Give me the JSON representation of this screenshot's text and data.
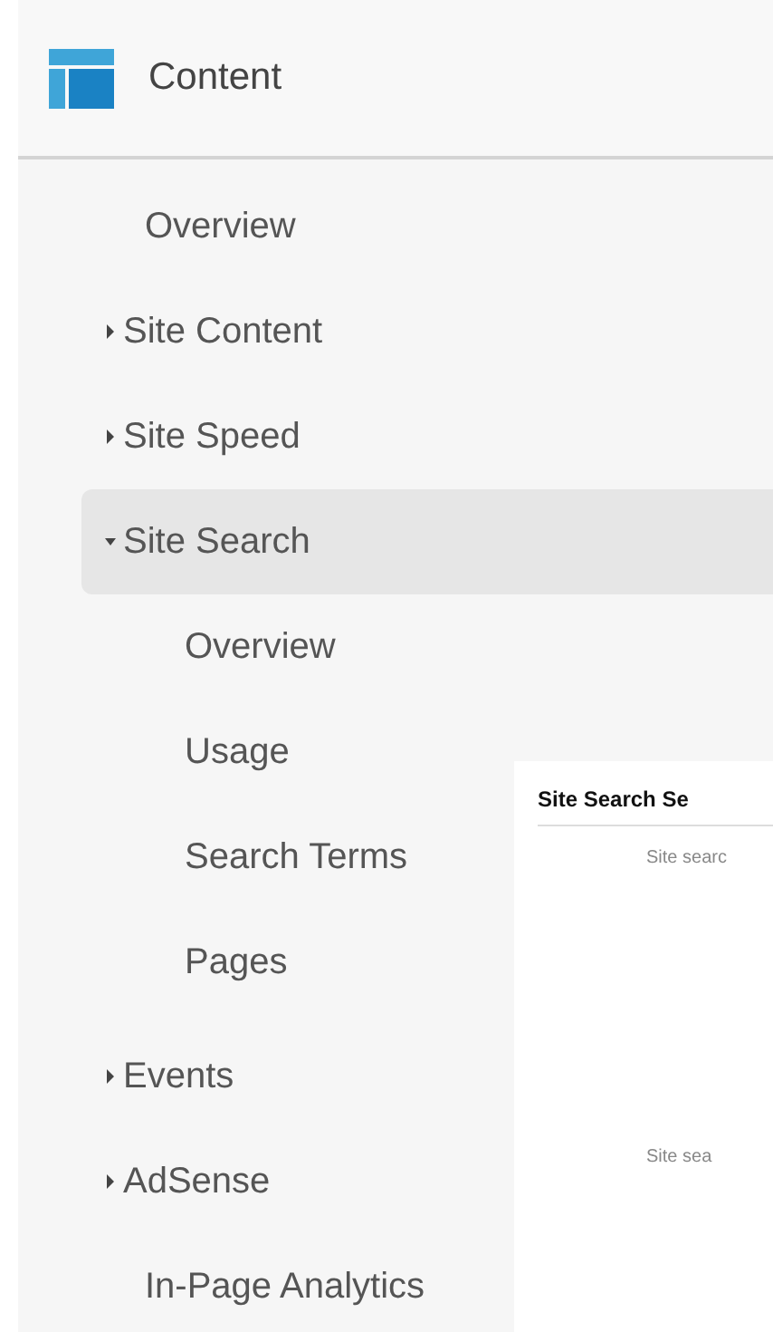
{
  "section": {
    "title": "Content"
  },
  "nav": [
    {
      "kind": "link",
      "label": "Overview",
      "selected": false
    },
    {
      "kind": "group",
      "label": "Site Content",
      "expanded": false,
      "selected": false
    },
    {
      "kind": "group",
      "label": "Site Speed",
      "expanded": false,
      "selected": false
    },
    {
      "kind": "group",
      "label": "Site Search",
      "expanded": true,
      "selected": true,
      "children": [
        {
          "label": "Overview"
        },
        {
          "label": "Usage"
        },
        {
          "label": "Search Terms"
        },
        {
          "label": "Pages"
        }
      ]
    },
    {
      "kind": "group",
      "label": "Events",
      "expanded": false,
      "selected": false
    },
    {
      "kind": "group",
      "label": "AdSense",
      "expanded": false,
      "selected": false
    },
    {
      "kind": "link",
      "label": "In-Page Analytics",
      "selected": false
    }
  ],
  "overlay": {
    "title": "Site Search Se",
    "lines": [
      "Site searc",
      "Site sea"
    ]
  }
}
